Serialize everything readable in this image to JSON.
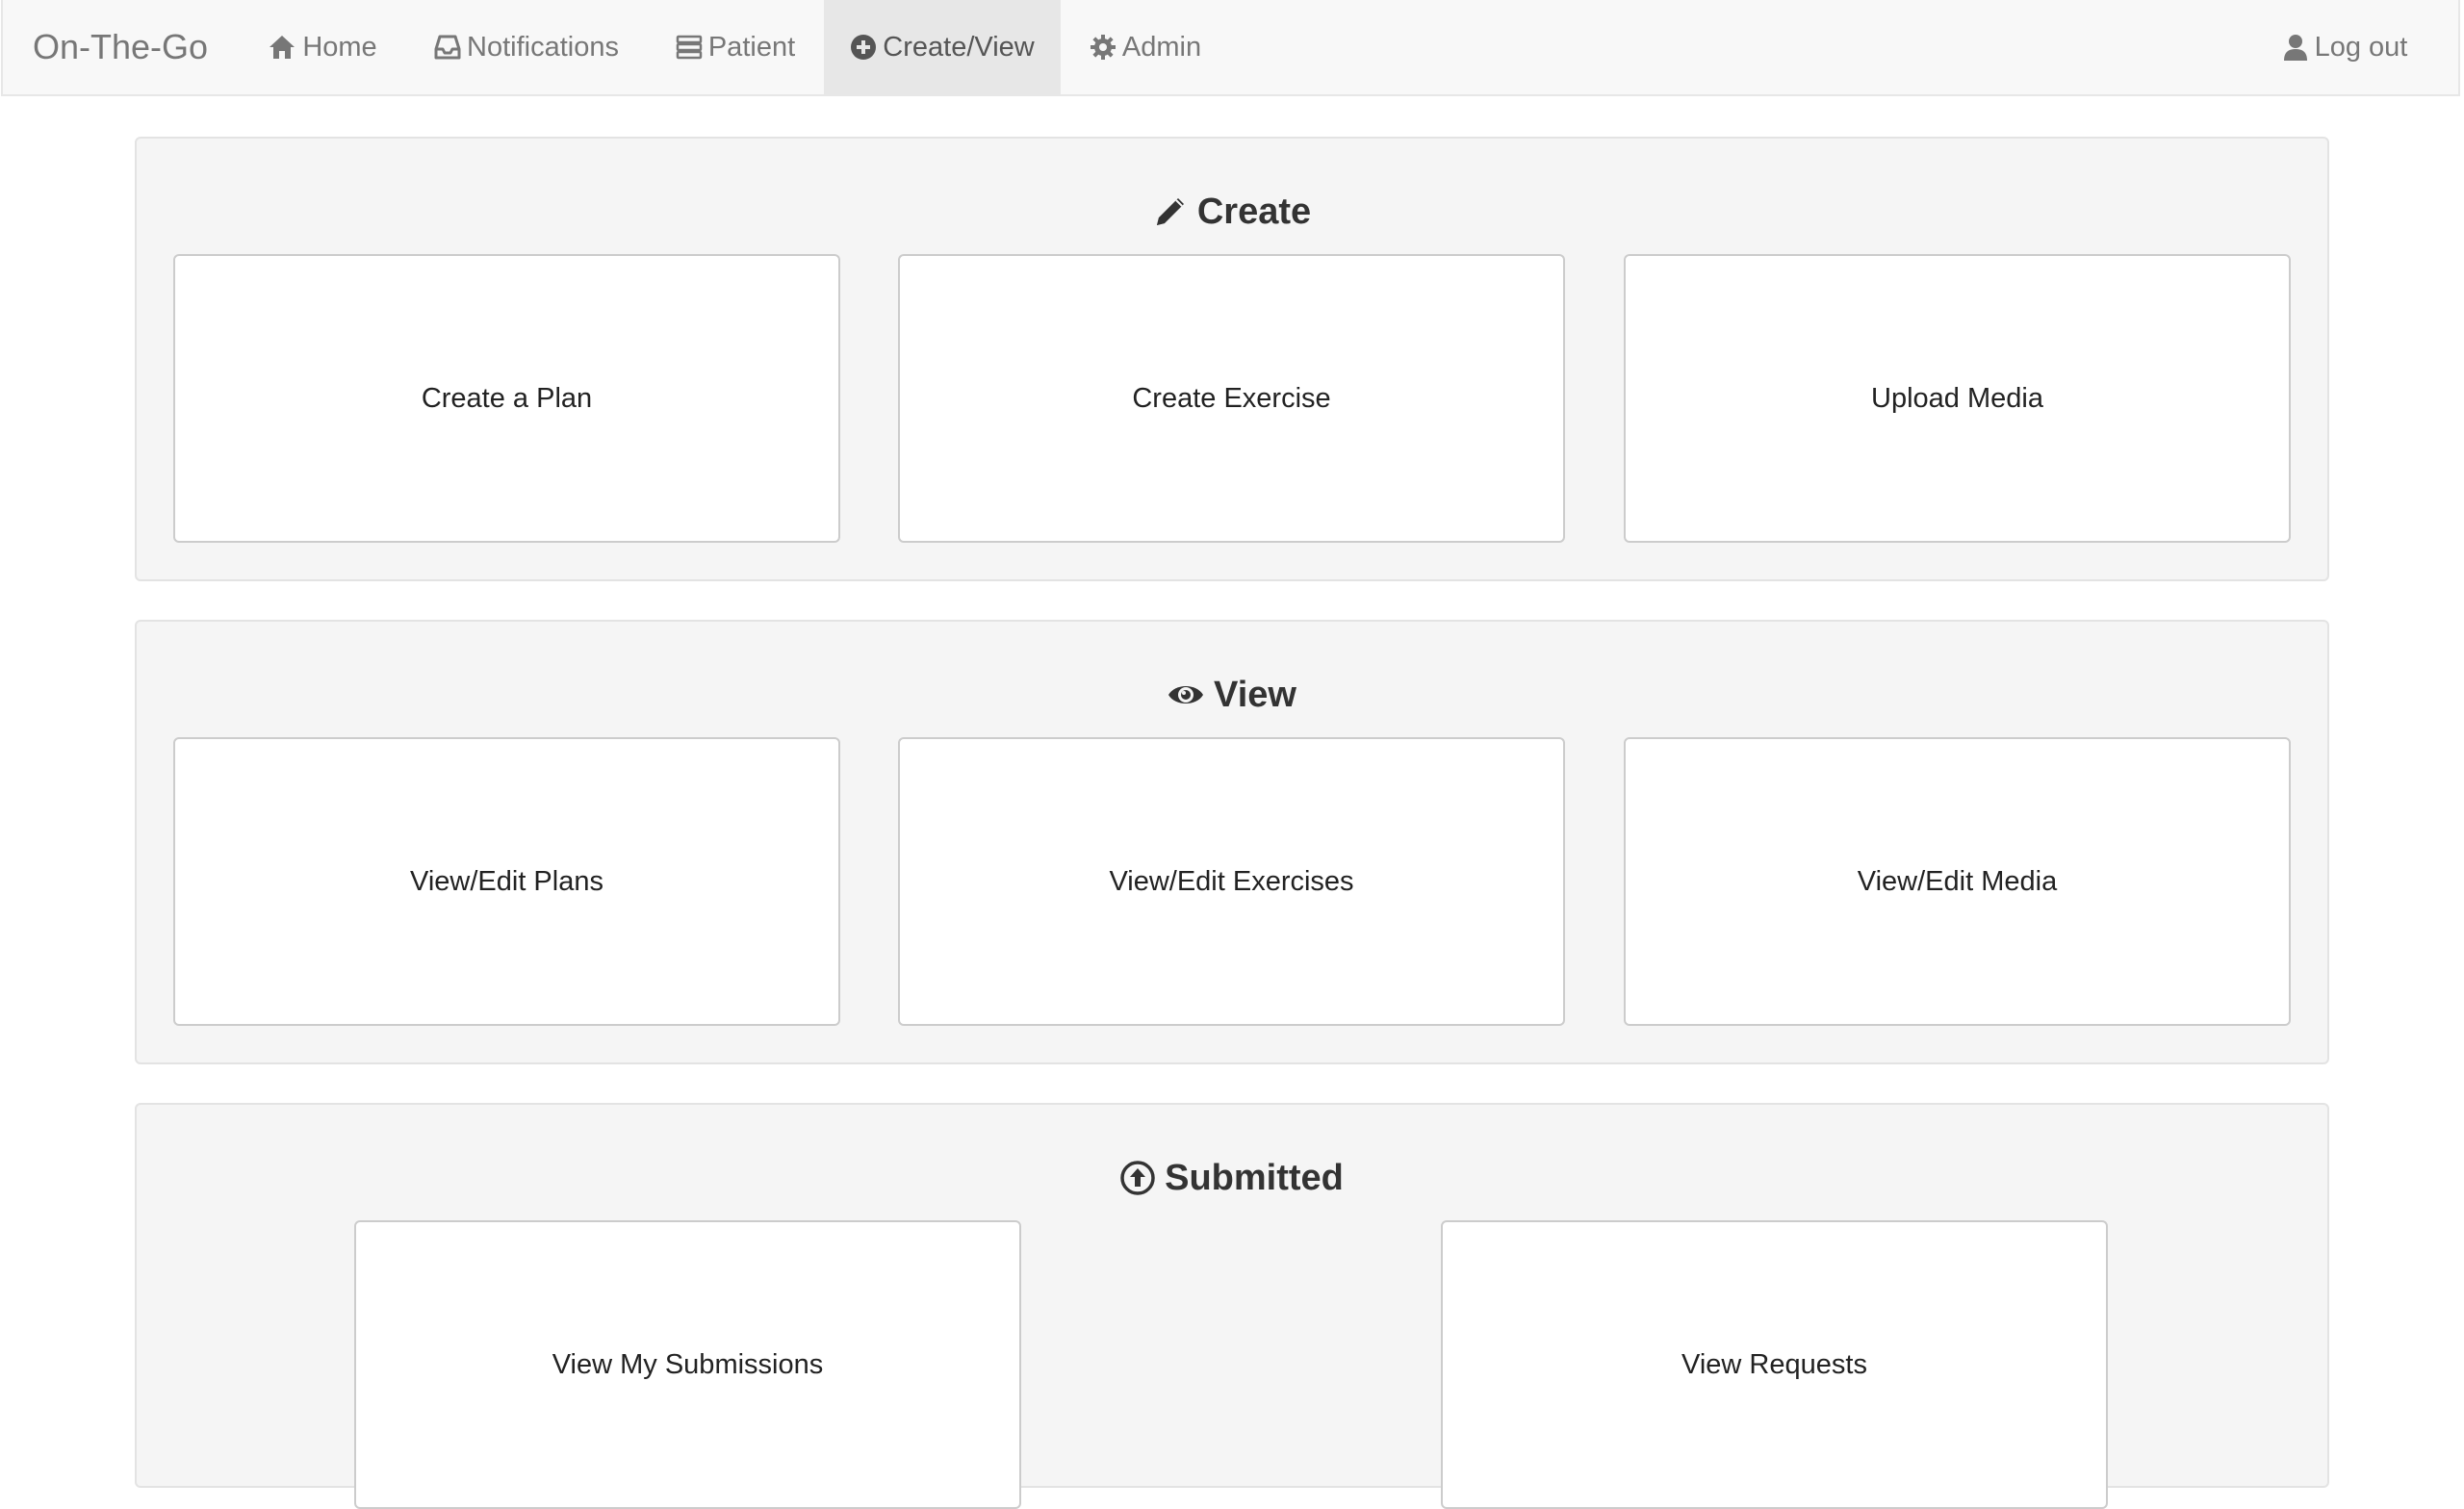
{
  "navbar": {
    "brand": "On-The-Go",
    "items": [
      {
        "label": "Home",
        "icon": "home-icon"
      },
      {
        "label": "Notifications",
        "icon": "inbox-icon"
      },
      {
        "label": "Patient",
        "icon": "list-icon"
      },
      {
        "label": "Create/View",
        "icon": "plus-circle-icon",
        "active": true
      },
      {
        "label": "Admin",
        "icon": "gear-icon"
      }
    ],
    "logout": {
      "label": "Log out",
      "icon": "user-icon"
    },
    "active_bg": "#e7e7e7"
  },
  "sections": {
    "create": {
      "title": "Create",
      "icon": "pencil-icon",
      "tiles": [
        "Create a Plan",
        "Create Exercise",
        "Upload Media"
      ]
    },
    "view": {
      "title": "View",
      "icon": "eye-icon",
      "tiles": [
        "View/Edit Plans",
        "View/Edit Exercises",
        "View/Edit Media"
      ]
    },
    "submitted": {
      "title": "Submitted",
      "icon": "upload-circle-icon",
      "tiles": [
        "View My Submissions",
        "View Requests"
      ]
    }
  }
}
